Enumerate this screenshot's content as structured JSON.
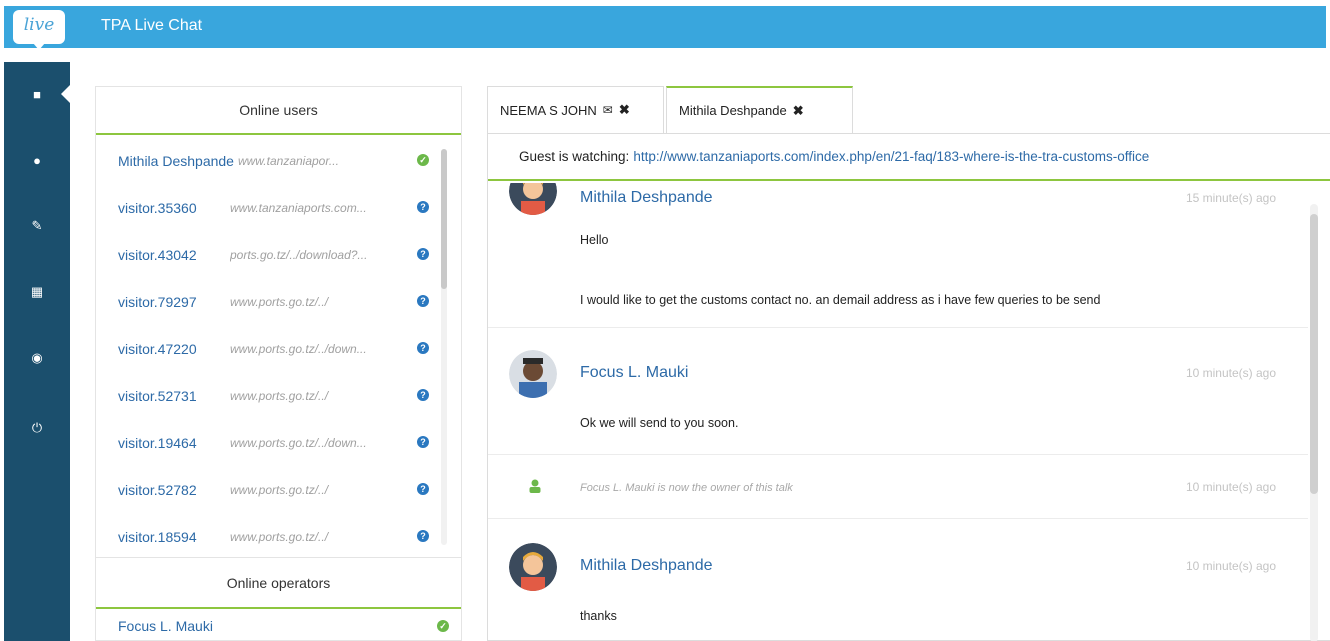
{
  "app": {
    "logo_text": "live",
    "title": "TPA Live Chat"
  },
  "sidebar": {
    "items": [
      {
        "icon": "chat-icon",
        "glyph": "■",
        "active": true
      },
      {
        "icon": "map-marker-icon",
        "glyph": "●"
      },
      {
        "icon": "wrench-icon",
        "glyph": "✎"
      },
      {
        "icon": "qrcode-icon",
        "glyph": "▦"
      },
      {
        "icon": "eye-icon",
        "glyph": "◉"
      },
      {
        "icon": "power-icon",
        "glyph": "⏻"
      }
    ]
  },
  "online_users": {
    "header": "Online users",
    "users": [
      {
        "name": "Mithila Deshpande",
        "url": "www.tanzaniapor...",
        "status": "online"
      },
      {
        "name": "visitor.35360",
        "url": "www.tanzaniaports.com...",
        "status": "info"
      },
      {
        "name": "visitor.43042",
        "url": "ports.go.tz/../download?...",
        "status": "info"
      },
      {
        "name": "visitor.79297",
        "url": "www.ports.go.tz/../",
        "status": "info"
      },
      {
        "name": "visitor.47220",
        "url": "www.ports.go.tz/../down...",
        "status": "info"
      },
      {
        "name": "visitor.52731",
        "url": "www.ports.go.tz/../",
        "status": "info"
      },
      {
        "name": "visitor.19464",
        "url": "www.ports.go.tz/../down...",
        "status": "info"
      },
      {
        "name": "visitor.52782",
        "url": "www.ports.go.tz/../",
        "status": "info"
      },
      {
        "name": "visitor.18594",
        "url": "www.ports.go.tz/../",
        "status": "info"
      }
    ]
  },
  "online_operators": {
    "header": "Online operators",
    "operators": [
      {
        "name": "Focus L. Mauki",
        "status": "online"
      }
    ]
  },
  "tabs": [
    {
      "label": "NEEMA S JOHN",
      "has_mail": true,
      "close": "✖"
    },
    {
      "label": "Mithila Deshpande",
      "active": true,
      "close": "✖"
    }
  ],
  "chat": {
    "watch_label": "Guest is watching:",
    "watch_url": "http://www.tanzaniaports.com/index.php/en/21-faq/183-where-is-the-tra-customs-office",
    "messages": [
      {
        "author": "Mithila Deshpande",
        "time": "15 minute(s) ago",
        "lines": [
          "Hello",
          "I would like to get the customs contact no. an demail address as i have few queries to be send"
        ]
      },
      {
        "author": "Focus L. Mauki",
        "time": "10 minute(s) ago",
        "lines": [
          "Ok we will send to you soon."
        ]
      },
      {
        "system": "Focus L. Mauki is now the owner of this talk",
        "time": "10 minute(s) ago"
      },
      {
        "author": "Mithila Deshpande",
        "time": "10 minute(s) ago",
        "lines": [
          "thanks"
        ]
      }
    ]
  },
  "colors": {
    "header": "#39a6dd",
    "sidebar": "#1b4f6d",
    "accent_green": "#8dc63f",
    "link": "#2d6aa7"
  }
}
